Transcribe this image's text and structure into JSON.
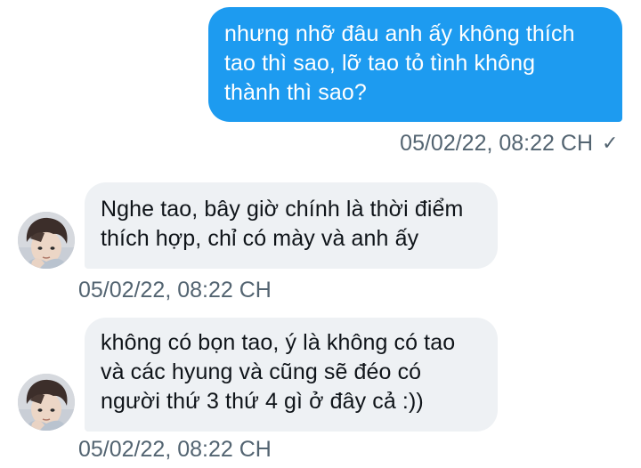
{
  "conversation": {
    "sent": [
      {
        "text": "nhưng nhỡ đâu anh ấy không thích\ntao thì sao, lỡ tao tỏ tình không\nthành thì sao?",
        "timestamp": "05/02/22, 08:22 CH",
        "status_icon": "checkmark-icon",
        "status_glyph": "✓",
        "bubble_color": "#1d9bf0"
      }
    ],
    "received": [
      {
        "text": "Nghe tao, bây giờ chính là thời điểm\nthích hợp, chỉ có mày và anh ấy",
        "timestamp": "05/02/22, 08:22 CH",
        "bubble_color": "#eef1f4"
      },
      {
        "text": "không có bọn tao, ý là không có tao\nvà các hyung và cũng sẽ đéo có\nngười thứ 3 thứ 4 gì ở đây cả :))",
        "timestamp": "05/02/22, 08:22 CH",
        "bubble_color": "#eef1f4"
      }
    ]
  },
  "colors": {
    "accent": "#1d9bf0",
    "timestamp_text": "#536471",
    "received_text": "#0f1419"
  }
}
